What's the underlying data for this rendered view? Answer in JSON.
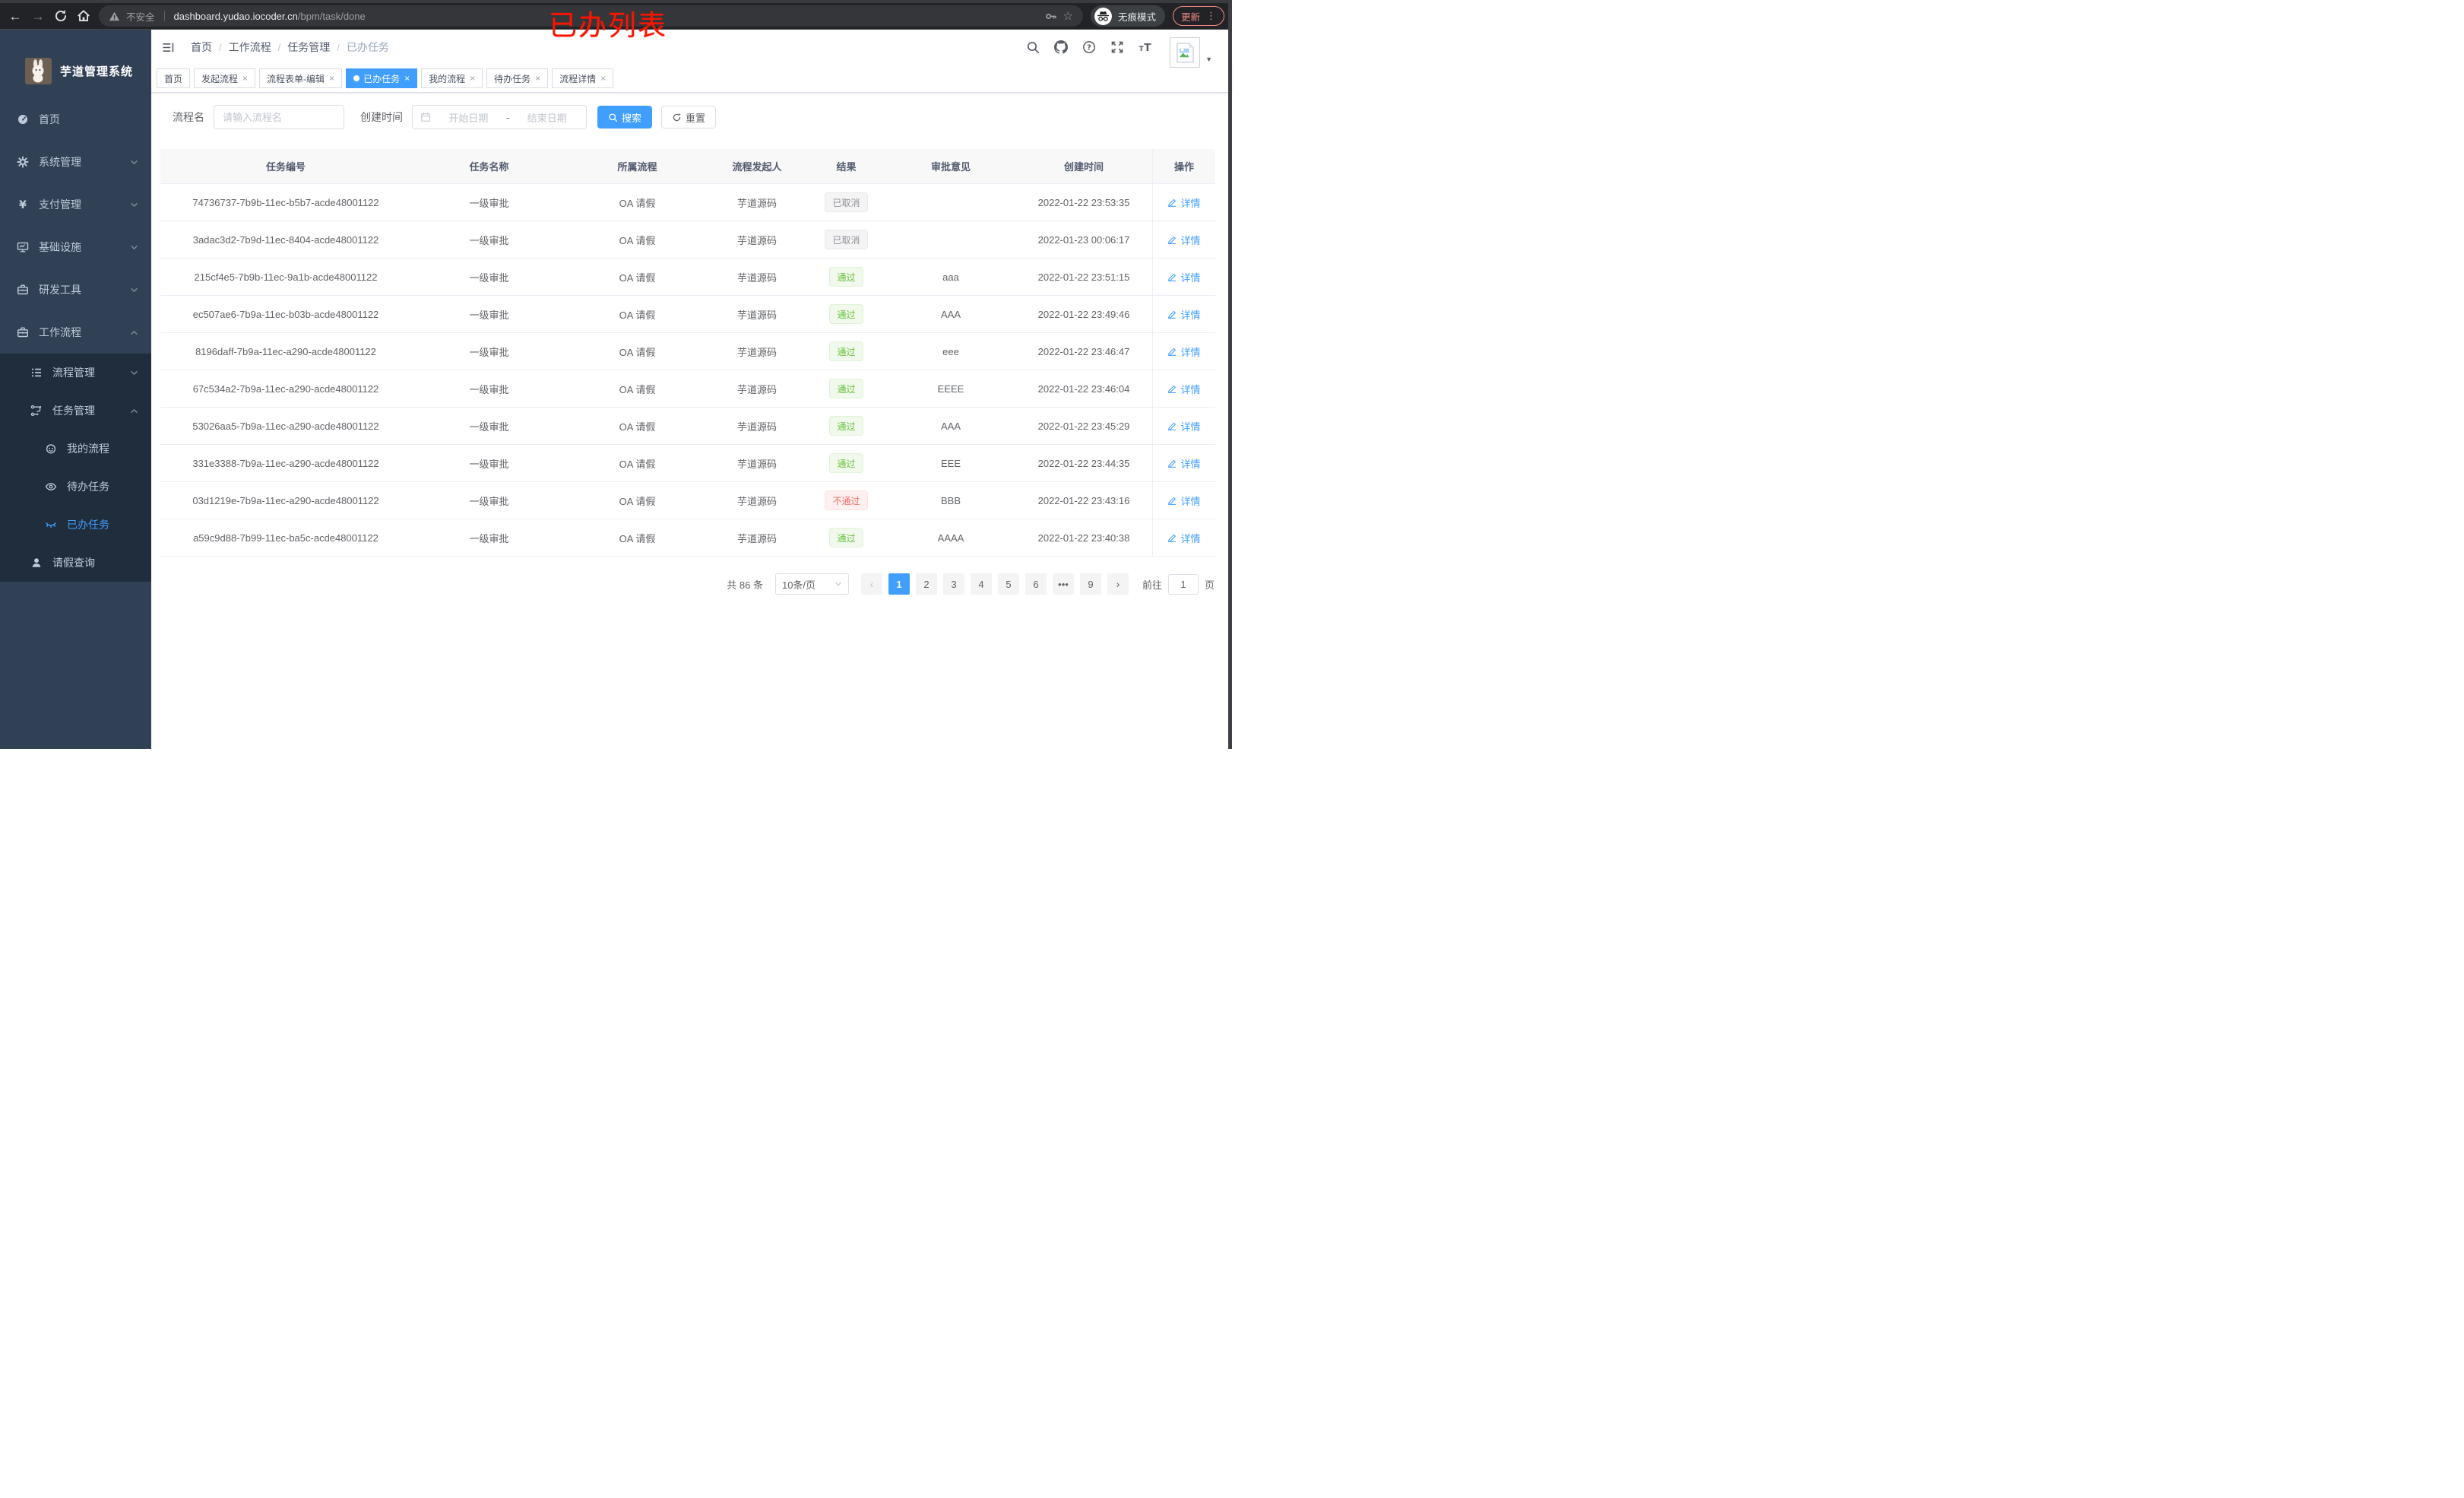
{
  "browser": {
    "security_label": "不安全",
    "url_host": "dashboard.yudao.iocoder.cn",
    "url_path": "/bpm/task/done",
    "incognito_label": "无痕模式",
    "update_label": "更新",
    "update_dots": "⋮",
    "annotation": "已办列表",
    "back_glyph": "←",
    "forward_glyph": "→",
    "star_glyph": "☆"
  },
  "sidebar": {
    "app_title": "芋道管理系统",
    "items": [
      {
        "key": "home",
        "label": "首页",
        "icon": "gauge",
        "level": 0,
        "sub": false
      },
      {
        "key": "system",
        "label": "系统管理",
        "icon": "gear",
        "level": 0,
        "sub": false,
        "chevron": "down"
      },
      {
        "key": "payment",
        "label": "支付管理",
        "icon": "yen",
        "level": 0,
        "sub": false,
        "chevron": "down"
      },
      {
        "key": "infra",
        "label": "基础设施",
        "icon": "monitor",
        "level": 0,
        "sub": false,
        "chevron": "down"
      },
      {
        "key": "devtools",
        "label": "研发工具",
        "icon": "briefcase",
        "level": 0,
        "sub": false,
        "chevron": "down"
      },
      {
        "key": "workflow",
        "label": "工作流程",
        "icon": "briefcase",
        "level": 0,
        "sub": false,
        "chevron": "up"
      },
      {
        "key": "process-mgmt",
        "label": "流程管理",
        "icon": "list",
        "level": 1,
        "sub": true,
        "chevron": "down"
      },
      {
        "key": "task-mgmt",
        "label": "任务管理",
        "icon": "tree",
        "level": 1,
        "sub": true,
        "chevron": "up"
      },
      {
        "key": "my-process",
        "label": "我的流程",
        "icon": "face",
        "level": 2,
        "sub": true
      },
      {
        "key": "todo-task",
        "label": "待办任务",
        "icon": "eye",
        "level": 2,
        "sub": true
      },
      {
        "key": "done-task",
        "label": "已办任务",
        "icon": "eye-closed",
        "level": 2,
        "sub": true,
        "active": true
      },
      {
        "key": "leave-query",
        "label": "请假查询",
        "icon": "user",
        "level": 1,
        "sub": true
      }
    ]
  },
  "topbar": {
    "breadcrumb": [
      "首页",
      "工作流程",
      "任务管理",
      "已办任务"
    ],
    "icons": [
      "search",
      "github",
      "help",
      "fullscreen",
      "font-size"
    ]
  },
  "tabs": [
    {
      "key": "home",
      "label": "首页",
      "closable": false,
      "active": false
    },
    {
      "key": "start-process",
      "label": "发起流程",
      "closable": true,
      "active": false
    },
    {
      "key": "form-edit",
      "label": "流程表单-编辑",
      "closable": true,
      "active": false
    },
    {
      "key": "done-task",
      "label": "已办任务",
      "closable": true,
      "active": true
    },
    {
      "key": "my-process",
      "label": "我的流程",
      "closable": true,
      "active": false
    },
    {
      "key": "todo-task",
      "label": "待办任务",
      "closable": true,
      "active": false
    },
    {
      "key": "process-detail",
      "label": "流程详情",
      "closable": true,
      "active": false
    }
  ],
  "filters": {
    "name_label": "流程名",
    "name_placeholder": "请输入流程名",
    "time_label": "创建时间",
    "start_placeholder": "开始日期",
    "range_separator": "-",
    "end_placeholder": "结束日期",
    "search_label": "搜索",
    "reset_label": "重置"
  },
  "table": {
    "columns": [
      "任务编号",
      "任务名称",
      "所属流程",
      "流程发起人",
      "结果",
      "审批意见",
      "创建时间",
      "操作"
    ],
    "action_label": "详情",
    "rows": [
      {
        "id": "74736737-7b9b-11ec-b5b7-acde48001122",
        "name": "一级审批",
        "process": "OA 请假",
        "starter": "芋道源码",
        "result": "已取消",
        "result_type": "info",
        "comment": "",
        "time": "2022-01-22 23:53:35"
      },
      {
        "id": "3adac3d2-7b9d-11ec-8404-acde48001122",
        "name": "一级审批",
        "process": "OA 请假",
        "starter": "芋道源码",
        "result": "已取消",
        "result_type": "info",
        "comment": "",
        "time": "2022-01-23 00:06:17"
      },
      {
        "id": "215cf4e5-7b9b-11ec-9a1b-acde48001122",
        "name": "一级审批",
        "process": "OA 请假",
        "starter": "芋道源码",
        "result": "通过",
        "result_type": "success",
        "comment": "aaa",
        "time": "2022-01-22 23:51:15"
      },
      {
        "id": "ec507ae6-7b9a-11ec-b03b-acde48001122",
        "name": "一级审批",
        "process": "OA 请假",
        "starter": "芋道源码",
        "result": "通过",
        "result_type": "success",
        "comment": "AAA",
        "time": "2022-01-22 23:49:46"
      },
      {
        "id": "8196daff-7b9a-11ec-a290-acde48001122",
        "name": "一级审批",
        "process": "OA 请假",
        "starter": "芋道源码",
        "result": "通过",
        "result_type": "success",
        "comment": "eee",
        "time": "2022-01-22 23:46:47"
      },
      {
        "id": "67c534a2-7b9a-11ec-a290-acde48001122",
        "name": "一级审批",
        "process": "OA 请假",
        "starter": "芋道源码",
        "result": "通过",
        "result_type": "success",
        "comment": "EEEE",
        "time": "2022-01-22 23:46:04"
      },
      {
        "id": "53026aa5-7b9a-11ec-a290-acde48001122",
        "name": "一级审批",
        "process": "OA 请假",
        "starter": "芋道源码",
        "result": "通过",
        "result_type": "success",
        "comment": "AAA",
        "time": "2022-01-22 23:45:29"
      },
      {
        "id": "331e3388-7b9a-11ec-a290-acde48001122",
        "name": "一级审批",
        "process": "OA 请假",
        "starter": "芋道源码",
        "result": "通过",
        "result_type": "success",
        "comment": "EEE",
        "time": "2022-01-22 23:44:35"
      },
      {
        "id": "03d1219e-7b9a-11ec-a290-acde48001122",
        "name": "一级审批",
        "process": "OA 请假",
        "starter": "芋道源码",
        "result": "不通过",
        "result_type": "danger",
        "comment": "BBB",
        "time": "2022-01-22 23:43:16"
      },
      {
        "id": "a59c9d88-7b99-11ec-ba5c-acde48001122",
        "name": "一级审批",
        "process": "OA 请假",
        "starter": "芋道源码",
        "result": "通过",
        "result_type": "success",
        "comment": "AAAA",
        "time": "2022-01-22 23:40:38"
      }
    ]
  },
  "pagination": {
    "total": "共 86 条",
    "page_size": "10条/页",
    "prev_glyph": "‹",
    "next_glyph": "›",
    "pages": [
      "1",
      "2",
      "3",
      "4",
      "5",
      "6",
      "•••",
      "9"
    ],
    "active_page": "1",
    "goto_label": "前往",
    "goto_value": "1",
    "unit_label": "页"
  },
  "colors": {
    "accent": "#409eff",
    "sidebar_bg": "#304156",
    "submenu_bg": "#1f2d3d",
    "success_text": "#67c23a",
    "danger_text": "#f56c6c",
    "info_text": "#909399",
    "annotation_red": "#fb1400"
  }
}
